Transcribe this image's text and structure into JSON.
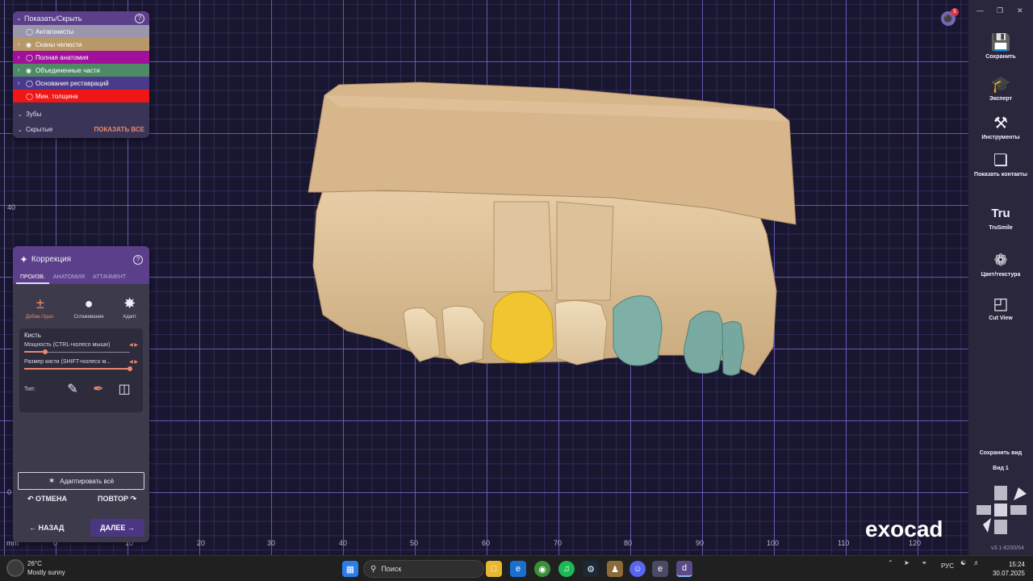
{
  "layers_panel": {
    "title": "Показать/Скрыть",
    "rows": [
      {
        "label": "Антагонисты",
        "color": "#9b96ac",
        "expandable": false,
        "eye": "eye-off-icon"
      },
      {
        "label": "Сканы челюсти",
        "color": "#b89868",
        "expandable": true,
        "eye": "eye-icon"
      },
      {
        "label": "Полная анатомия",
        "color": "#a0109a",
        "expandable": true,
        "eye": "eye-off-icon"
      },
      {
        "label": "Объединенные части",
        "color": "#4e8a66",
        "expandable": true,
        "eye": "eye-icon"
      },
      {
        "label": "Основания реставраций",
        "color": "#4b3a8c",
        "expandable": true,
        "eye": "eye-off-icon"
      },
      {
        "label": "Мин. толщина",
        "color": "#ee1616",
        "expandable": false,
        "eye": "eye-off-icon"
      }
    ],
    "teeth_label": "Зубы",
    "hidden_label": "Скрытые",
    "show_all": "ПОКАЗАТЬ ВСЕ"
  },
  "correction_panel": {
    "title": "Коррекция",
    "tabs": [
      "ПРОИЗВ.",
      "АНАТОМИЯ",
      "АТТАЧМЕНТ"
    ],
    "active_tab": 0,
    "tools": [
      {
        "label": "Добав./Удал.",
        "icon": "plus-minus-icon",
        "active": true
      },
      {
        "label": "Сглаживание",
        "icon": "drop-icon",
        "active": false
      },
      {
        "label": "Адапт",
        "icon": "adapt-icon",
        "active": false
      }
    ],
    "brush": {
      "title": "Кисть",
      "strength_label": "Мощность (CTRL+колесо мыши)",
      "strength_value": 0.2,
      "size_label": "Размер кисти (SHIFT+колесо м...",
      "size_value": 1.0,
      "type_label": "Тип:"
    },
    "adapt_all": "Адаптировать всё",
    "undo": "ОТМЕНА",
    "redo": "ПОВТОР",
    "back": "НАЗАД",
    "next": "ДАЛЕЕ"
  },
  "toolbar": {
    "buttons": [
      {
        "label": "Сохранить",
        "icon": "save-icon"
      },
      {
        "label": "Эксперт",
        "icon": "graduation-cap-icon"
      },
      {
        "label": "Инструменты",
        "icon": "tools-icon"
      },
      {
        "label": "Показать контакты",
        "icon": "contacts-icon"
      },
      {
        "label": "TruSmile",
        "icon": "trusmile-icon"
      },
      {
        "label": "Цвет/текстура",
        "icon": "palette-icon"
      },
      {
        "label": "Cut View",
        "icon": "cut-view-icon"
      }
    ],
    "save_view": "Сохранить вид",
    "view_name": "Вид 1",
    "version": "v3.1-8200/64"
  },
  "viewport": {
    "x_ticks": [
      "mm",
      "0",
      "10",
      "20",
      "30",
      "40",
      "50",
      "60",
      "70",
      "80",
      "90",
      "100",
      "110",
      "120"
    ],
    "y_ticks": [
      "40",
      "0"
    ],
    "notification_count": "5",
    "brand": "exocad"
  },
  "taskbar": {
    "temperature": "26°C",
    "weather": "Mostly sunny",
    "search_placeholder": "Поиск",
    "language": "РУС",
    "time": "15:24",
    "date": "30.07.2025"
  }
}
